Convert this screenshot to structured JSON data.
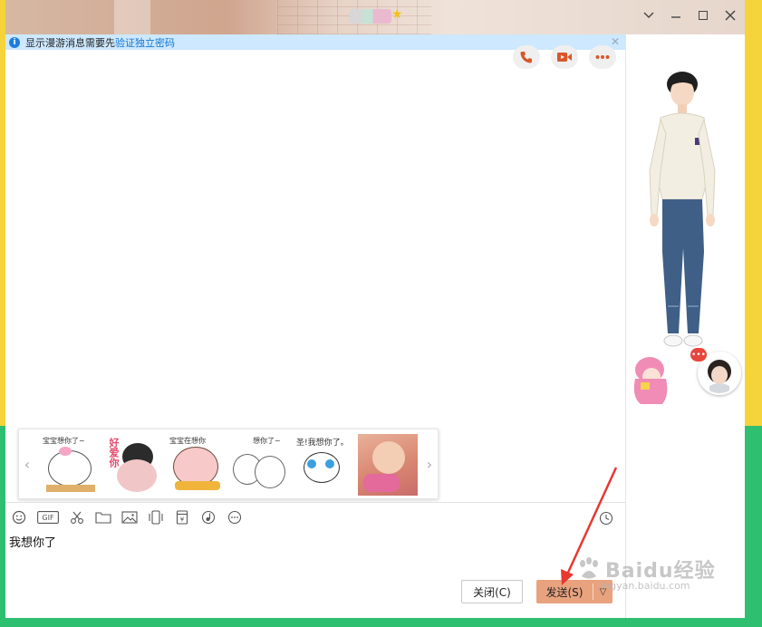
{
  "notice": {
    "text": "显示漫游消息需要先",
    "link": "验证独立密码"
  },
  "stickers": [
    {
      "caption": "宝宝想你了~"
    },
    {
      "caption": "好爱你"
    },
    {
      "caption": "宝宝在想你"
    },
    {
      "caption": "想你了~"
    },
    {
      "caption": "圣!我想你了。"
    },
    {
      "caption": ""
    }
  ],
  "input": {
    "text": "我想你了"
  },
  "buttons": {
    "close": "关闭(C)",
    "send": "发送(S)",
    "send_dropdown": "▽"
  },
  "avatar_badge": "•••",
  "watermark": {
    "brand": "Baidu经验",
    "url": "jingyan.baidu.com"
  },
  "colors": {
    "send_button": "#e8a27e",
    "notice_bg": "#cde8ff",
    "link": "#1677d3",
    "annotation_arrow": "#e8382f"
  }
}
